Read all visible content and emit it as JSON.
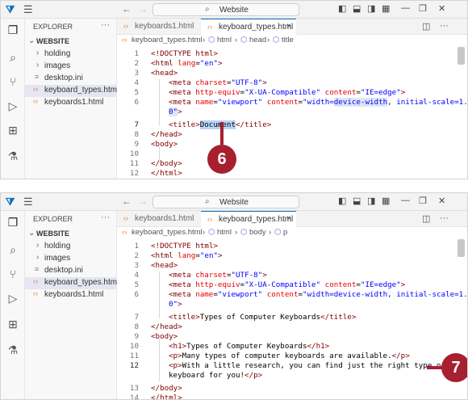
{
  "colors": {
    "accent": "#0a6fc2",
    "callout": "#a7202f",
    "html_icon": "#e37933",
    "selection": "#b7d4f7"
  },
  "common": {
    "search_text": "Website",
    "explorer_title": "EXPLORER",
    "more_icon": "ellipsis-icon",
    "root": "WEBSITE",
    "tree": {
      "holding": "holding",
      "images": "images",
      "desktop": "desktop.ini",
      "kbtypes": "keyboard_types.html",
      "kb1": "keyboards1.html"
    },
    "tabs": {
      "t1": "keyboards1.html",
      "t2": "keyboard_types.html"
    },
    "close": "×"
  },
  "panel1": {
    "crumbs": {
      "file": "keyboard_types.html",
      "c1": "html",
      "c2": "head",
      "c3": "title"
    },
    "lines": {
      "l1": "<!DOCTYPE html>",
      "l2a": "<html ",
      "l2b": "lang",
      "l2c": "=",
      "l2d": "\"en\"",
      "l2e": ">",
      "l3": "<head>",
      "l4a": "<meta ",
      "l4b": "charset",
      "l4c": "=",
      "l4d": "\"UTF-8\"",
      "l4e": ">",
      "l5a": "<meta ",
      "l5b": "http-equiv",
      "l5c": "=",
      "l5d": "\"X-UA-Compatible\"",
      "l5e": " content",
      "l5f": "=",
      "l5g": "\"IE=edge\"",
      "l5h": ">",
      "l6a": "<meta ",
      "l6b": "name",
      "l6c": "=",
      "l6d": "\"viewport\"",
      "l6e": " content",
      "l6f": "=",
      "l6g": "\"width=",
      "l6h": "device-width",
      "l6i": ", initial-scale=1.",
      "l6w": "0\"",
      "l6x": ">",
      "l7a": "<title>",
      "l7b": "Document",
      "l7c": "</title>",
      "l8": "</head>",
      "l9": "<body>",
      "l11": "</body>",
      "l12": "</html>"
    },
    "callout": "6"
  },
  "panel2": {
    "crumbs": {
      "file": "keyboard_types.html",
      "c1": "html",
      "c2": "body",
      "c3": "p"
    },
    "lines": {
      "l1": "<!DOCTYPE html>",
      "l2a": "<html ",
      "l2b": "lang",
      "l2c": "=",
      "l2d": "\"en\"",
      "l2e": ">",
      "l3": "<head>",
      "l4a": "<meta ",
      "l4b": "charset",
      "l4c": "=",
      "l4d": "\"UTF-8\"",
      "l4e": ">",
      "l5a": "<meta ",
      "l5b": "http-equiv",
      "l5c": "=",
      "l5d": "\"X-UA-Compatible\"",
      "l5e": " content",
      "l5f": "=",
      "l5g": "\"IE=edge\"",
      "l5h": ">",
      "l6a": "<meta ",
      "l6b": "name",
      "l6c": "=",
      "l6d": "\"viewport\"",
      "l6e": " content",
      "l6f": "=",
      "l6g": "\"width=device-width, initial-scale=1.",
      "l6w": "0\"",
      "l6x": ">",
      "l7a": "<title>",
      "l7b": "Types of Computer Keyboards",
      "l7c": "</title>",
      "l8": "</head>",
      "l9": "<body>",
      "l10a": "<h1>",
      "l10b": "Types of Computer Keyboards",
      "l10c": "</h1>",
      "l11a": "<p>",
      "l11b": "Many types of computer keyboards are available.",
      "l11c": "</p>",
      "l12a": "<p>",
      "l12b": "With a little research, you can find just the right type of",
      "l12w": "keyboard for you!",
      "l12c": "</p>",
      "l13": "</body>",
      "l14": "</html>"
    },
    "callout": "7"
  },
  "line_numbers": {
    "n1": "1",
    "n2": "2",
    "n3": "3",
    "n4": "4",
    "n5": "5",
    "n6": "6",
    "n7": "7",
    "n8": "8",
    "n9": "9",
    "n10": "10",
    "n11": "11",
    "n12": "12",
    "n13": "13",
    "n14": "14"
  }
}
